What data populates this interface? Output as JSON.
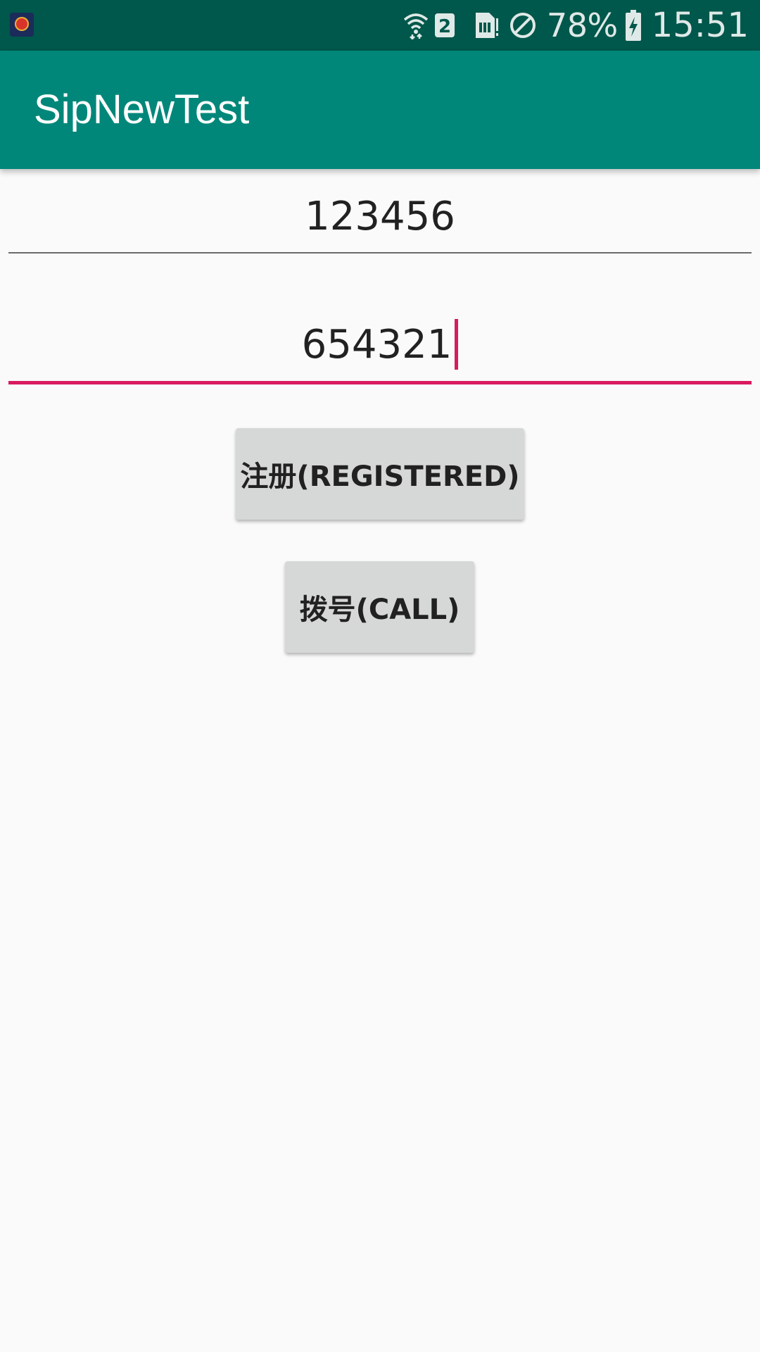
{
  "status_bar": {
    "notification_icon": "app-emblem-icon",
    "sim_label": "2",
    "battery": "78%",
    "time": "15:51",
    "icons": [
      "wifi-icon",
      "sim-2-icon",
      "sim-card-icon",
      "do-not-disturb-icon",
      "battery-charging-icon"
    ]
  },
  "app_bar": {
    "title": "SipNewTest"
  },
  "form": {
    "field1_value": "123456",
    "field2_value": "654321"
  },
  "buttons": {
    "register_label": "注册(REGISTERED)",
    "call_label": "拨号(CALL)"
  },
  "colors": {
    "status_bar": "#00574b",
    "app_bar": "#00877a",
    "accent": "#d81b60",
    "button": "#d6d7d7",
    "background": "#fafafa"
  }
}
